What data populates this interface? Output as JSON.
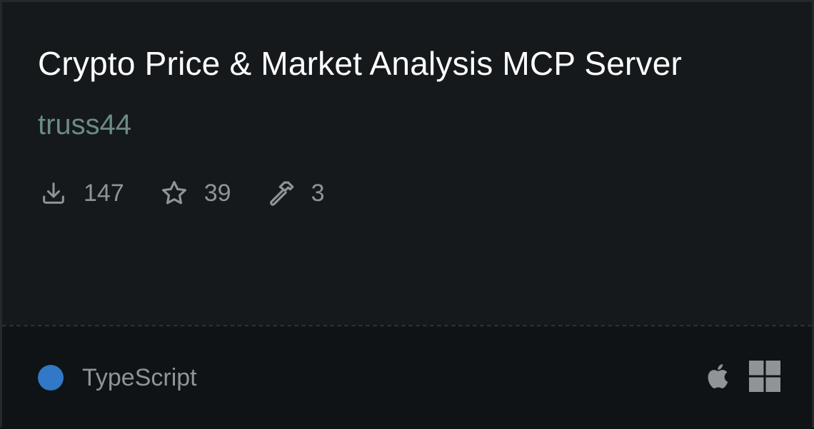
{
  "card": {
    "title": "Crypto Price & Market Analysis MCP Server",
    "author": "truss44",
    "stats": {
      "downloads": "147",
      "stars": "39",
      "tools": "3"
    },
    "language": {
      "name": "TypeScript",
      "color": "#3178c6"
    },
    "platforms": [
      "apple-icon",
      "windows-icon"
    ]
  }
}
